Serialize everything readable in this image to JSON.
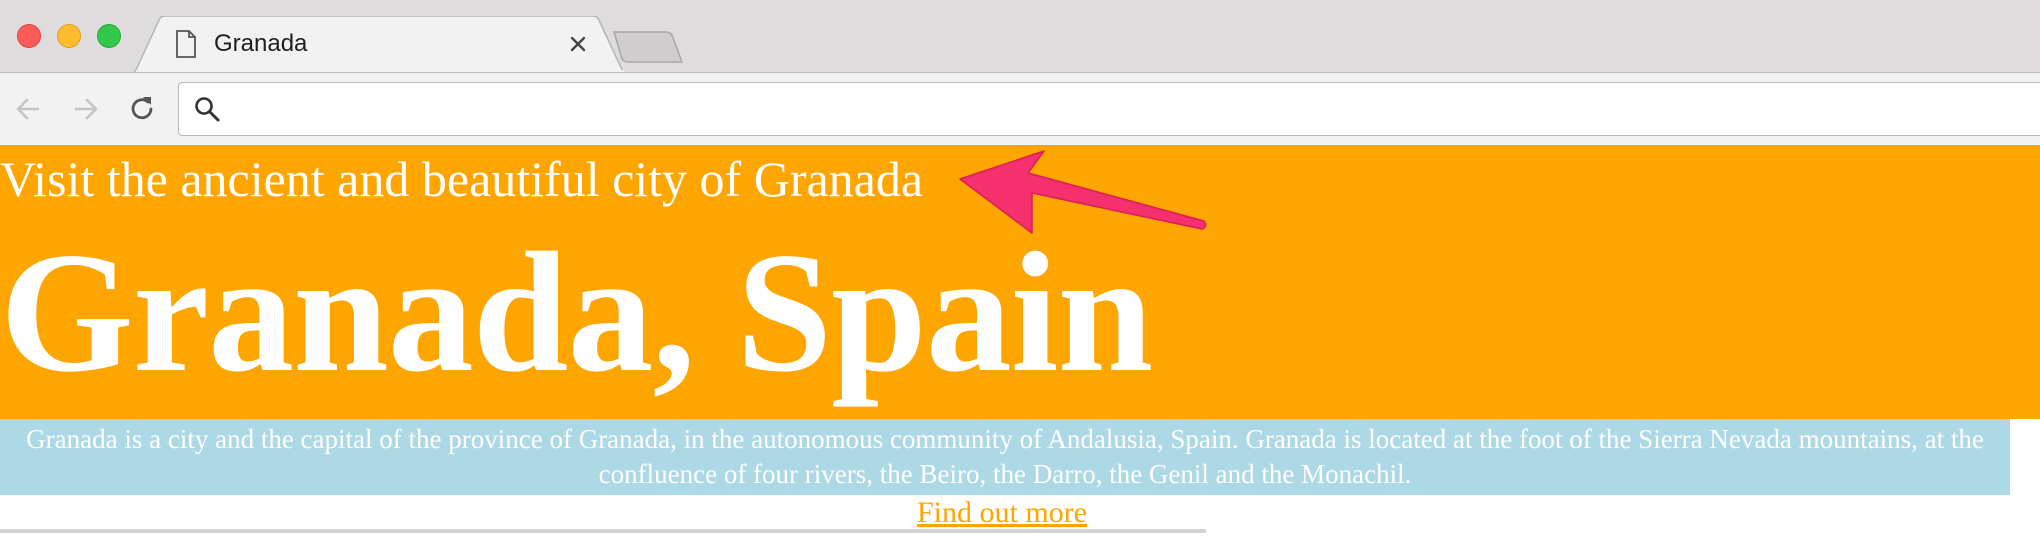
{
  "window": {
    "controls": [
      "close",
      "minimize",
      "maximize"
    ]
  },
  "tab": {
    "title": "Granada",
    "icon": "page-icon",
    "close_icon": "close-icon"
  },
  "toolbar": {
    "back_icon": "back-arrow-icon",
    "forward_icon": "forward-arrow-icon",
    "reload_icon": "reload-icon",
    "omnibox": {
      "search_icon": "search-icon",
      "value": ""
    }
  },
  "page": {
    "tagline": "Visit the ancient and beautiful city of Granada",
    "title": "Granada, Spain",
    "intro": "Granada is a city and the capital of the province of Granada, in the autonomous community of Andalusia, Spain. Granada is located at the foot of the Sierra Nevada mountains, at the confluence of four rivers, the Beiro, the Darro, the Genil and the Monachil.",
    "link": "Find out more"
  },
  "annotation": {
    "icon": "pointer-arrow-icon"
  },
  "colors": {
    "hero_background": "#ffa500",
    "intro_background": "#add8e6",
    "link": "#ffa500",
    "annotation_arrow": "#f5306e",
    "text_on_color": "#ffffff"
  }
}
